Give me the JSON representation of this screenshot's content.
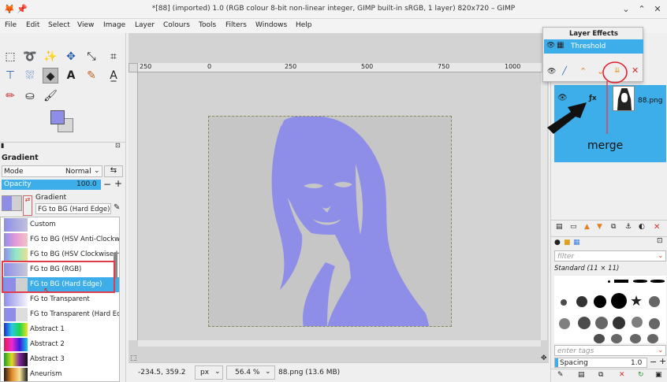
{
  "window": {
    "title": "*[88] (imported) 1.0 (RGB colour 8-bit non-linear integer, GIMP built-in sRGB, 1 layer) 820x720 – GIMP"
  },
  "menubar": [
    "File",
    "Edit",
    "Select",
    "View",
    "Image",
    "Layer",
    "Colours",
    "Tools",
    "Filters",
    "Windows",
    "Help"
  ],
  "tool_options": {
    "title": "Gradient",
    "mode_label": "Mode",
    "mode_value": "Normal",
    "opacity_label": "Opacity",
    "opacity_value": "100.0",
    "gradient_label": "Gradient",
    "gradient_value": "FG to BG (Hard Edge)"
  },
  "gradients": [
    {
      "label": "Custom",
      "bg": "linear-gradient(90deg,#8e8ee8,#c0c0dc)"
    },
    {
      "label": "FG to BG (HSV Anti-Clockwise)",
      "bg": "linear-gradient(90deg,#8e8ee8,#e79ad6,#f0c6c6)"
    },
    {
      "label": "FG to BG (HSV Clockwise Hue)",
      "bg": "linear-gradient(90deg,#8e8ee8,#8ee8c9,#e8e08e)"
    },
    {
      "label": "FG to BG (RGB)",
      "bg": "linear-gradient(90deg,#8e8ee8,#c8c8d8)"
    },
    {
      "label": "FG to BG (Hard Edge)",
      "bg": "linear-gradient(90deg,#8e8ee8 50%,#d0d0d0 50%)"
    },
    {
      "label": "FG to Transparent",
      "bg": "linear-gradient(90deg,#8e8ee8,rgba(142,142,232,0.1))"
    },
    {
      "label": "FG to Transparent (Hard Edge)",
      "bg": "linear-gradient(90deg,#8e8ee8 50%,#ddd 50%)"
    },
    {
      "label": "Abstract 1",
      "bg": "linear-gradient(90deg,#1a2ad6,#29c7e6,#1dd64a,#f4e21a)"
    },
    {
      "label": "Abstract 2",
      "bg": "linear-gradient(90deg,#e01a4a,#f02ad0,#3a1ae0,#12d0e0)"
    },
    {
      "label": "Abstract 3",
      "bg": "linear-gradient(90deg,#16a020,#e0e020,#8020a0,#101010)"
    },
    {
      "label": "Aneurism",
      "bg": "linear-gradient(90deg,#2a1a10,#e08a2a,#f6e49a,#1a1a1a)"
    }
  ],
  "ruler_ticks": [
    "250",
    "0",
    "250",
    "500",
    "750",
    "1000"
  ],
  "status": {
    "coords": "-234.5, 359.2",
    "unit": "px",
    "zoom": "56.4 %",
    "file": "88.png (13.6 MB)"
  },
  "layer_effects": {
    "title": "Layer Effects",
    "effect": "Threshold"
  },
  "layers": {
    "fx_label": "ƒx",
    "layer_name": "88.png"
  },
  "annotation": {
    "text": "merge"
  },
  "brushes": {
    "filter_placeholder": "filter",
    "title": "Standard (11 × 11)",
    "tags_placeholder": "enter tags",
    "spacing_label": "Spacing",
    "spacing_value": "1.0"
  },
  "colors": {
    "foreground": "#8e8ee8",
    "background": "#d7d7d7",
    "accent": "#3daee9",
    "image_fg": "#8e8ee8"
  }
}
